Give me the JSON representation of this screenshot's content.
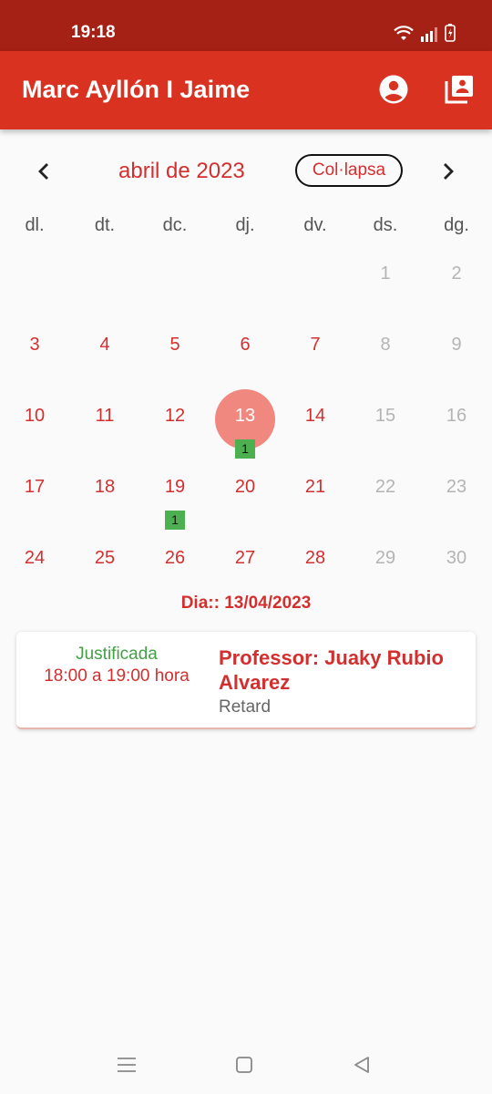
{
  "status_bar": {
    "time": "19:18"
  },
  "app_bar": {
    "title": "Marc Ayllón I Jaime",
    "actions": [
      {
        "icon": "account-circle-icon"
      },
      {
        "icon": "library-books-icon"
      }
    ]
  },
  "calendar": {
    "month_title": "abril de 2023",
    "collapse_label": "Col·lapsa",
    "prev_icon": "chevron-left-icon",
    "next_icon": "chevron-right-icon",
    "weekdays": [
      "dl.",
      "dt.",
      "dc.",
      "dj.",
      "dv.",
      "ds.",
      "dg."
    ],
    "weeks": [
      [
        null,
        null,
        null,
        null,
        null,
        {
          "day": "1"
        },
        {
          "day": "2"
        }
      ],
      [
        {
          "day": "3"
        },
        {
          "day": "4"
        },
        {
          "day": "5"
        },
        {
          "day": "6"
        },
        {
          "day": "7"
        },
        {
          "day": "8"
        },
        {
          "day": "9"
        }
      ],
      [
        {
          "day": "10"
        },
        {
          "day": "11"
        },
        {
          "day": "12"
        },
        {
          "day": "13",
          "selected": true,
          "badge": "1"
        },
        {
          "day": "14"
        },
        {
          "day": "15"
        },
        {
          "day": "16"
        }
      ],
      [
        {
          "day": "17"
        },
        {
          "day": "18"
        },
        {
          "day": "19",
          "badge": "1"
        },
        {
          "day": "20"
        },
        {
          "day": "21"
        },
        {
          "day": "22"
        },
        {
          "day": "23"
        }
      ],
      [
        {
          "day": "24"
        },
        {
          "day": "25"
        },
        {
          "day": "26"
        },
        {
          "day": "27"
        },
        {
          "day": "28"
        },
        {
          "day": "29"
        },
        {
          "day": "30"
        }
      ]
    ],
    "selected_day_label": "Dia:: 13/04/2023"
  },
  "events": [
    {
      "status": "Justificada",
      "time": "18:00 a 19:00 hora",
      "title": "Professor: Juaky Rubio Alvarez",
      "type": "Retard"
    }
  ],
  "colors": {
    "status_bar": "#a52015",
    "app_bar": "#d93221",
    "accent": "#d32f2f",
    "selected_day": "#f08880",
    "badge": "#4caf50",
    "justified": "#43a047",
    "weekend": "#b4b4b4"
  },
  "system_nav": {
    "icons": [
      "menu-icon",
      "home-icon",
      "back-icon"
    ]
  }
}
